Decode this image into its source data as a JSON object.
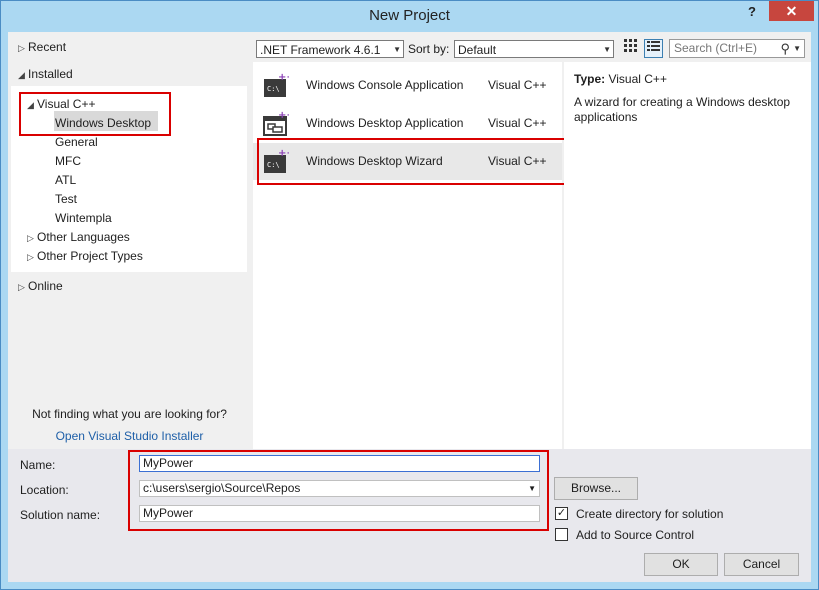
{
  "window": {
    "title": "New Project",
    "help": "?",
    "close": "✕"
  },
  "tree": {
    "recent": "Recent",
    "installed": "Installed",
    "visual_cpp": "Visual C++",
    "children": [
      "Windows Desktop",
      "General",
      "MFC",
      "ATL",
      "Test",
      "Wintempla"
    ],
    "other_languages": "Other Languages",
    "other_project_types": "Other Project Types",
    "online": "Online",
    "not_finding": "Not finding what you are looking for?",
    "installer_link": "Open Visual Studio Installer"
  },
  "toolbar": {
    "framework": ".NET Framework 4.6.1",
    "sort_by_label": "Sort by:",
    "sort_by_value": "Default",
    "search_placeholder": "Search (Ctrl+E)"
  },
  "templates": [
    {
      "name": "Windows Console Application",
      "language": "Visual C++",
      "icon": "console-icon"
    },
    {
      "name": "Windows Desktop Application",
      "language": "Visual C++",
      "icon": "desktop-app-icon"
    },
    {
      "name": "Windows Desktop Wizard",
      "language": "Visual C++",
      "icon": "console-icon",
      "selected": true
    }
  ],
  "details": {
    "type_label": "Type:",
    "type_value": "Visual C++",
    "description": "A wizard for creating a Windows desktop applications"
  },
  "form": {
    "name_label": "Name:",
    "name_value": "MyPower",
    "location_label": "Location:",
    "location_value": "c:\\users\\sergio\\Source\\Repos",
    "solution_label": "Solution name:",
    "solution_value": "MyPower",
    "browse": "Browse...",
    "create_dir": "Create directory for solution",
    "create_dir_checked": true,
    "add_source": "Add to Source Control",
    "add_source_checked": false,
    "ok": "OK",
    "cancel": "Cancel"
  },
  "colors": {
    "highlight": "#d90000",
    "link": "#1e5fa8",
    "close": "#c7463e"
  }
}
